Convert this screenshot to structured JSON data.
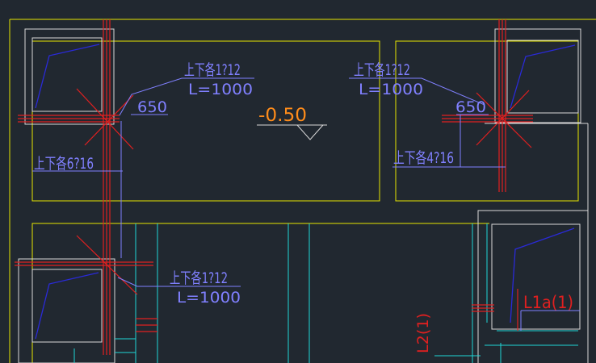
{
  "colors": {
    "background": "#212830",
    "outline": "#e6e600",
    "column_box": "#d9d9d9",
    "rebar_red": "#e02020",
    "annot_blue": "#8080ff",
    "stirrup_blue": "#2a2ad8",
    "cyan": "#20d6d6",
    "elevation_orange": "#ff8c1a"
  },
  "annotations": {
    "rebar_top_left": "上下各1?12",
    "length_top_left": "L=1000",
    "rebar_top_right": "上下各1?12",
    "length_top_right": "L=1000",
    "rebar_bottom_left": "上下各1?12",
    "length_bottom_left": "L=1000",
    "dim_left": "650",
    "dim_right": "650",
    "bars_left": "上下各6?16",
    "bars_right": "上下各4?16",
    "elevation": "-0.50",
    "beam_l1a": "L1a(1)",
    "beam_l2": "L2(1)"
  }
}
